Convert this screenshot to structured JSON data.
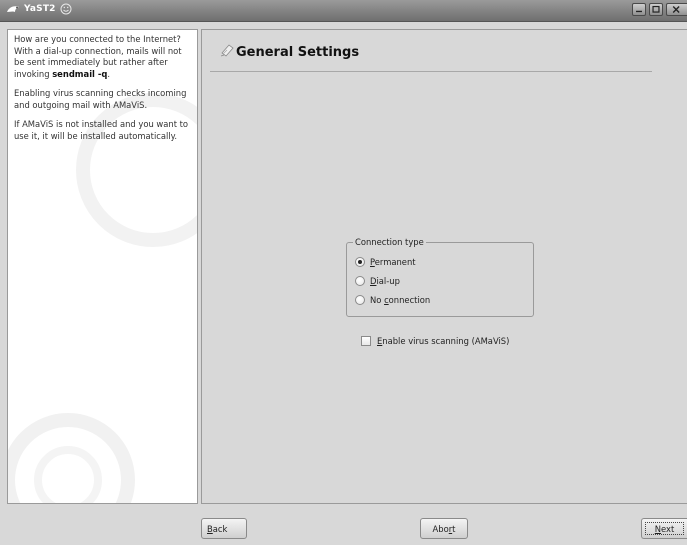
{
  "window": {
    "title": "YaST2",
    "buttons": [
      "minimize",
      "maximize",
      "close"
    ],
    "icons": {
      "app": "gecko-icon",
      "help": "help-face-icon"
    }
  },
  "help": {
    "paragraphs": [
      {
        "before": "How are you connected to the Internet? With a dial-up connection, mails will not be sent immediately but rather after invoking ",
        "command": "sendmail -q",
        "after": "."
      },
      {
        "text": "Enabling virus scanning checks incoming and outgoing mail with AMaViS."
      },
      {
        "text": "If AMaViS is not installed and you want to use it, it will be installed automatically."
      }
    ]
  },
  "main": {
    "heading": "General Settings",
    "connection_type": {
      "legend": "Connection type",
      "options": [
        {
          "pre": "",
          "key": "P",
          "post": "ermanent",
          "checked": true
        },
        {
          "pre": "",
          "key": "D",
          "post": "ial-up",
          "checked": false
        },
        {
          "pre": "No ",
          "key": "c",
          "post": "onnection",
          "checked": false
        }
      ]
    },
    "virus_scan": {
      "pre": "",
      "key": "E",
      "post": "nable virus scanning (AMaViS)",
      "checked": false
    }
  },
  "footer": {
    "back": {
      "pre": "",
      "key": "B",
      "post": "ack"
    },
    "abort": {
      "pre": "Abo",
      "key": "r",
      "post": "t"
    },
    "next": {
      "pre": "",
      "key": "N",
      "post": "ext"
    }
  }
}
